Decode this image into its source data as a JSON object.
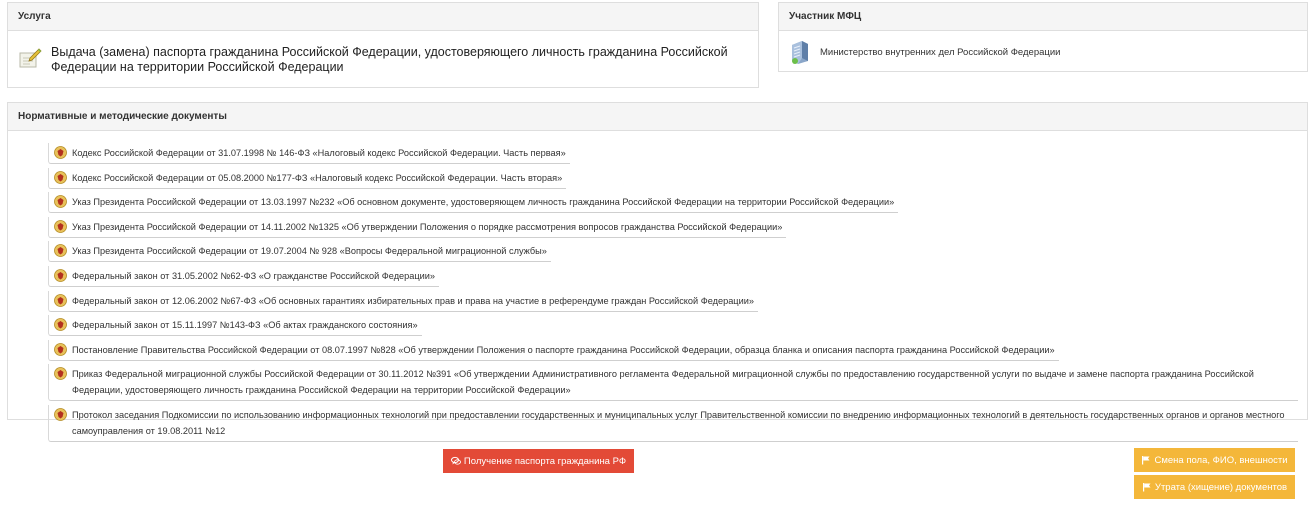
{
  "service_panel": {
    "title": "Услуга",
    "text": "Выдача (замена) паспорта гражданина Российской Федерации, удостоверяющего личность гражданина Российской Федерации на территории Российской Федерации"
  },
  "mfc_panel": {
    "title": "Участник МФЦ",
    "text": "Министерство внутренних дел Российской Федерации"
  },
  "docs_panel": {
    "title": "Нормативные и методические документы",
    "items": [
      "Кодекс Российской Федерации от 31.07.1998 № 146-ФЗ «Налоговый кодекс Российской Федерации. Часть первая»",
      "Кодекс Российской Федерации от 05.08.2000 №177-ФЗ «Налоговый кодекс Российской Федерации. Часть вторая»",
      "Указ Президента Российской Федерации от 13.03.1997 №232 «Об основном документе, удостоверяющем личность гражданина Российской Федерации на территории Российской Федерации»",
      "Указ Президента Российской Федерации от 14.11.2002 №1325 «Об утверждении Положения о порядке рассмотрения вопросов гражданства Российской Федерации»",
      "Указ Президента Российской Федерации от 19.07.2004 № 928 «Вопросы Федеральной миграционной службы»",
      "Федеральный закон от 31.05.2002 №62-ФЗ «О гражданстве Российской Федерации»",
      "Федеральный закон от 12.06.2002 №67-ФЗ «Об основных гарантиях избирательных прав и права на участие в референдуме граждан Российской Федерации»",
      "Федеральный закон от 15.11.1997 №143-ФЗ «Об актах гражданского состояния»",
      "Постановление Правительства Российской Федерации от 08.07.1997 №828 «Об утверждении Положения о паспорте гражданина Российской Федерации, образца бланка и описания паспорта гражданина Российской Федерации»",
      "Приказ Федеральной миграционной службы Российской Федерации от 30.11.2012 №391 «Об утверждении Административного регламента Федеральной миграционной службы по предоставлению государственной услуги по выдаче и замене паспорта гражданина Российской Федерации, удостоверяющего личность гражданина Российской Федерации на территории Российской Федерации»",
      "Протокол заседания Подкомиссии по использованию информационных технологий при предоставлении государственных и муниципальных услуг Правительственной комиссии по внедрению информационных технологий в деятельность государственных органов и органов местного самоуправления от 19.08.2011 №12"
    ]
  },
  "buttons": {
    "receive": "Получение паспорта гражданина РФ",
    "change": "Смена пола, ФИО, внешности",
    "loss": "Утрата (хищение) документов"
  },
  "colors": {
    "red_button": "#e34a37",
    "orange_button": "#f4b73a"
  },
  "icons": {
    "service": "document-pencil-icon",
    "mfc": "building-icon",
    "doc": "emblem-icon",
    "receive": "comments-icon",
    "flag": "flag-icon"
  }
}
